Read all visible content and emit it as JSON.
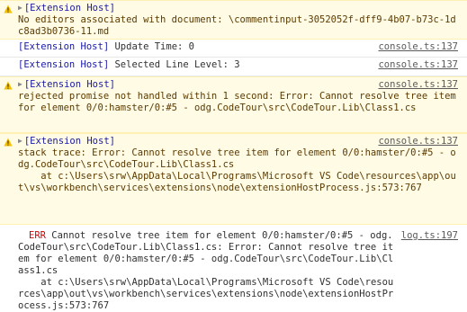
{
  "console": {
    "entries": [
      {
        "level": "warning",
        "tag": "[Extension Host]",
        "source": "",
        "text": "No editors associated with document: \\commentinput-3052052f-dff9-4b07-b73c-1dc8ad3b0736-11.md"
      },
      {
        "level": "info",
        "tag": "[Extension Host]",
        "inline_text": " Update Time: 0",
        "source": "console.ts:137"
      },
      {
        "level": "info",
        "tag": "[Extension Host]",
        "inline_text": " Selected Line Level: 3",
        "source": "console.ts:137"
      },
      {
        "level": "warning",
        "tag": "[Extension Host]",
        "source": "console.ts:137",
        "text": "rejected promise not handled within 1 second: Error: Cannot resolve tree item for element 0/0:hamster/0:#5 - odg.CodeTour\\src\\CodeTour.Lib\\Class1.cs"
      },
      {
        "level": "warning",
        "tag": "[Extension Host]",
        "source": "console.ts:137",
        "text": "stack trace: Error: Cannot resolve tree item for element 0/0:hamster/0:#5 - odg.CodeTour\\src\\CodeTour.Lib\\Class1.cs\n    at c:\\Users\\srw\\AppData\\Local\\Programs\\Microsoft VS Code\\resources\\app\\out\\vs\\workbench\\services\\extensions\\node\\extensionHostProcess.js:573:767"
      },
      {
        "level": "error",
        "label": "ERR",
        "source": "log.ts:197",
        "text": " Cannot resolve tree item for element 0/0:hamster/0:#5 - odg.CodeTour\\src\\CodeTour.Lib\\Class1.cs: Error: Cannot resolve tree item for element 0/0:hamster/0:#5 - odg.CodeTour\\src\\CodeTour.Lib\\Class1.cs\n    at c:\\Users\\srw\\AppData\\Local\\Programs\\Microsoft VS Code\\resources\\app\\out\\vs\\workbench\\services\\extensions\\node\\extensionHostProcess.js:573:767"
      }
    ]
  },
  "colors": {
    "warning_bg": "#fffbe5",
    "warning_text": "#5c3b00",
    "tag": "#1a1aa6",
    "error_label": "#d00000",
    "warning_icon": "#f2c000"
  }
}
